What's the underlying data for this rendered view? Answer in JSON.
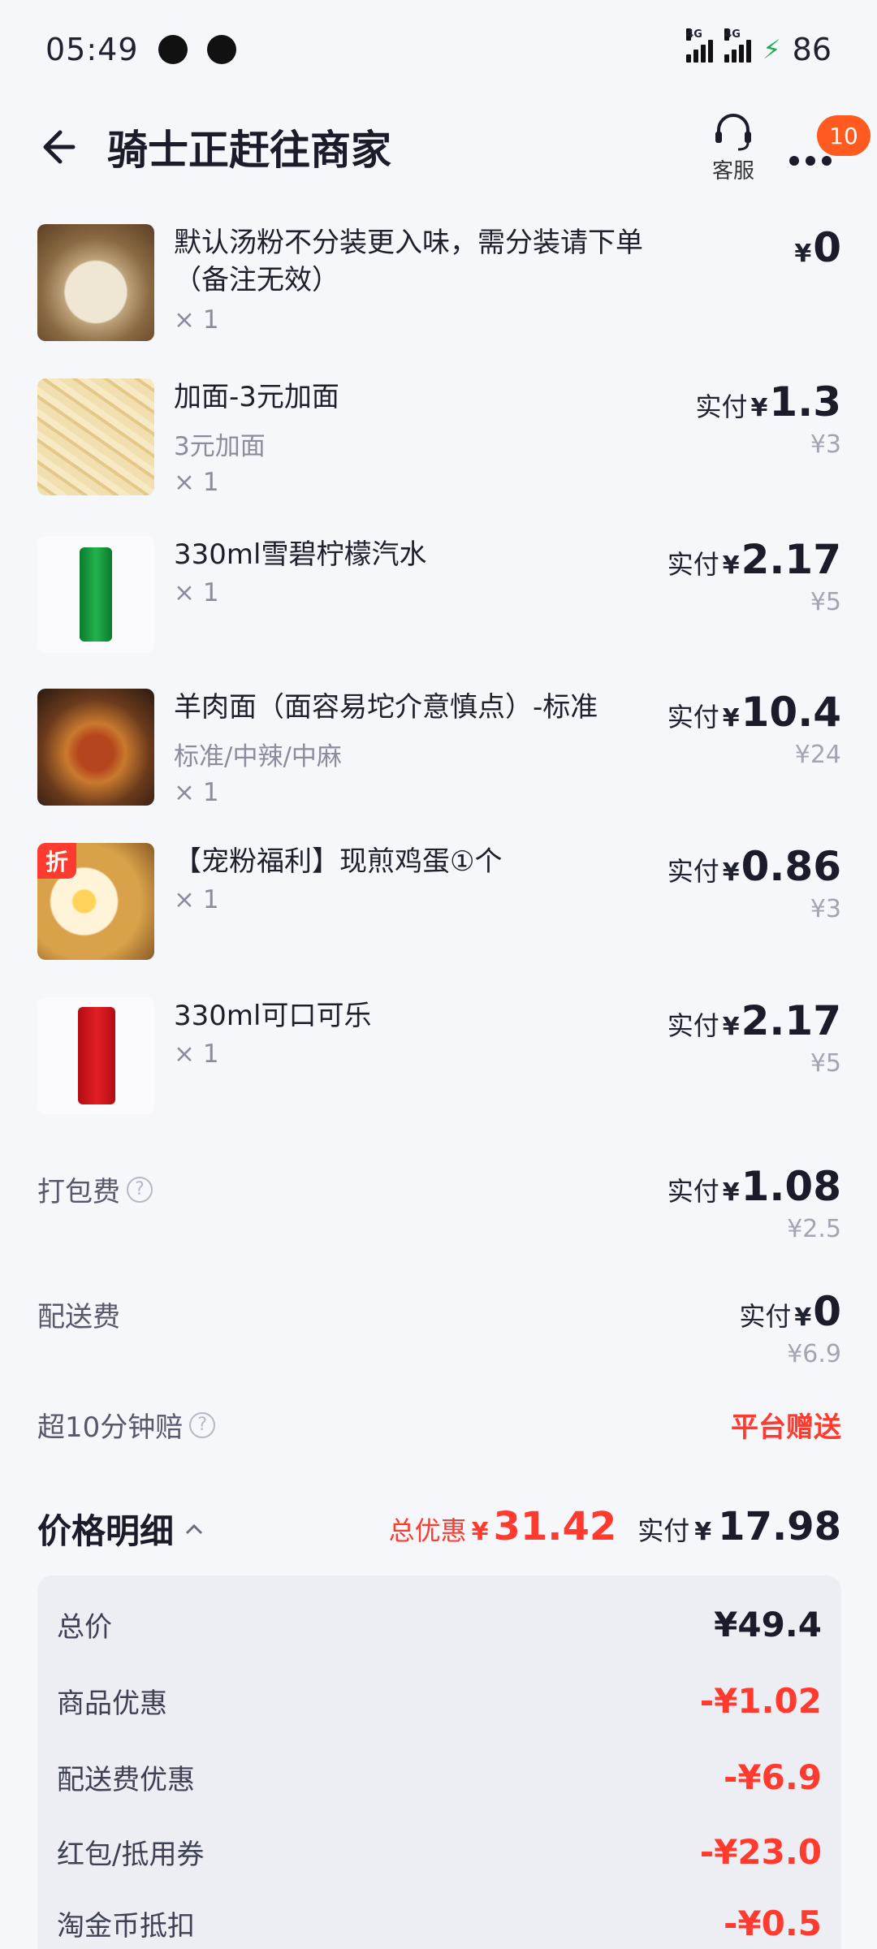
{
  "status_bar": {
    "time": "05:49",
    "network_1": "4G",
    "network_2": "4G",
    "battery": "86"
  },
  "header": {
    "title": "骑士正赶往商家",
    "service_label": "客服",
    "badge": "10"
  },
  "items": [
    {
      "name": "默认汤粉不分装更入味，需分装请下单（备注无效）",
      "spec": "",
      "qty": "× 1",
      "paid_label": "",
      "currency": "¥",
      "paid": "0",
      "original": ""
    },
    {
      "name": "加面-3元加面",
      "spec": "3元加面",
      "qty": "× 1",
      "paid_label": "实付",
      "currency": "¥",
      "paid": "1.3",
      "original": "¥3"
    },
    {
      "name": "330ml雪碧柠檬汽水",
      "spec": "",
      "qty": "× 1",
      "paid_label": "实付",
      "currency": "¥",
      "paid": "2.17",
      "original": "¥5"
    },
    {
      "name": "羊肉面（面容易坨介意慎点）-标准",
      "spec": "标准/中辣/中麻",
      "qty": "× 1",
      "paid_label": "实付",
      "currency": "¥",
      "paid": "10.4",
      "original": "¥24"
    },
    {
      "name": "【宠粉福利】现煎鸡蛋①个",
      "spec": "",
      "qty": "× 1",
      "paid_label": "实付",
      "currency": "¥",
      "paid": "0.86",
      "original": "¥3",
      "tag": "折"
    },
    {
      "name": "330ml可口可乐",
      "spec": "",
      "qty": "× 1",
      "paid_label": "实付",
      "currency": "¥",
      "paid": "2.17",
      "original": "¥5"
    }
  ],
  "fees": {
    "packing": {
      "label": "打包费",
      "paid_label": "实付",
      "currency": "¥",
      "paid": "1.08",
      "original": "¥2.5"
    },
    "delivery": {
      "label": "配送费",
      "paid_label": "实付",
      "currency": "¥",
      "paid": "0",
      "original": "¥6.9"
    },
    "late_comp": {
      "label": "超10分钟赔",
      "value": "平台赠送"
    }
  },
  "price_detail": {
    "title": "价格明细",
    "discount_label": "总优惠",
    "currency": "¥",
    "discount": "31.42",
    "paid_label": "实付",
    "paid": "17.98"
  },
  "breakdown": [
    {
      "label": "总价",
      "value": "¥49.4",
      "red": false
    },
    {
      "label": "商品优惠",
      "value": "-¥1.02",
      "red": true
    },
    {
      "label": "配送费优惠",
      "value": "-¥6.9",
      "red": true
    },
    {
      "label": "红包/抵用券",
      "value": "-¥23.0",
      "red": true
    },
    {
      "label": "淘金币抵扣",
      "value": "-¥0.5",
      "red": true
    }
  ],
  "colors": {
    "accent_red": "#ff3b30",
    "badge_orange": "#ff5a1f",
    "background": "#f6f7fb"
  }
}
